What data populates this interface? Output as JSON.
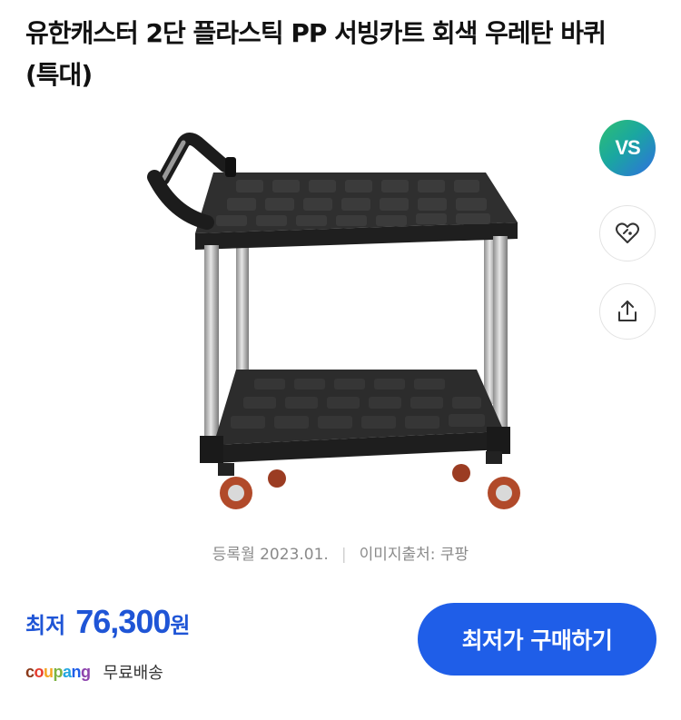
{
  "product": {
    "title": "유한캐스터 2단 플라스틱 PP 서빙카트 회색 우레탄 바퀴 (특대)"
  },
  "side_actions": {
    "vs_label": "VS",
    "wishlist_icon": "heart-tag-icon",
    "share_icon": "share-icon"
  },
  "meta": {
    "registered": "등록월 2023.01.",
    "separator": "|",
    "image_source": "이미지출처: 쿠팡"
  },
  "price": {
    "label": "최저",
    "value": "76,300",
    "unit": "원"
  },
  "seller": {
    "logo_letters": [
      "c",
      "o",
      "u",
      "p",
      "a",
      "n",
      "g"
    ],
    "logo_colors": [
      "#8b3a1a",
      "#e73c2e",
      "#f5a623",
      "#7cb342",
      "#22a6e0",
      "#1f5ee8",
      "#8e44ad"
    ],
    "shipping": "무료배송"
  },
  "buy_button": {
    "label": "최저가 구매하기"
  },
  "colors": {
    "accent": "#1f5ee8",
    "price": "#1f55d6"
  }
}
